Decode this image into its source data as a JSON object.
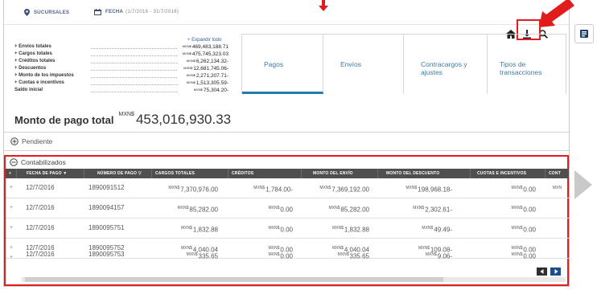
{
  "filters": {
    "branches_label": "SUCURSALES",
    "date_label": "FECHA",
    "date_range": "(1/7/2016 - 31/7/2016)"
  },
  "summary": {
    "expand_label": "+ Expandir todo",
    "rows": [
      {
        "label": "+ Envíos totales",
        "currency": "MXN$",
        "value": "469,483,188.71"
      },
      {
        "label": "+ Cargos totales",
        "currency": "MXN$",
        "value": "475,745,323.03"
      },
      {
        "label": "+ Créditos totales",
        "currency": "MXN$",
        "value": "6,262,134.32-"
      },
      {
        "label": "+ Descuentos",
        "currency": "MXN$",
        "value": "12,681,745.06-"
      },
      {
        "label": "+ Monto de los impuestos",
        "currency": "MXN$",
        "value": "2,271,207.71-"
      },
      {
        "label": "+ Cuotas e incentivos",
        "currency": "MXN$",
        "value": "1,513,305.59-"
      },
      {
        "label": "Saldo inicial",
        "currency": "MXN$",
        "value": "75,304.20-"
      }
    ],
    "total_label": "Monto de pago total",
    "total_currency": "MXN$",
    "total_value": "453,016,930.33"
  },
  "tabs": [
    {
      "label": "Pagos"
    },
    {
      "label": "Envíos"
    },
    {
      "label": "Contracargos y ajustes"
    },
    {
      "label": "Tipos de transacciones"
    }
  ],
  "sections": {
    "pending": "Pendiente",
    "posted": "Contabilizados"
  },
  "table": {
    "columns": [
      "+",
      "FECHA DE PAGO ▼",
      "NÚMERO DE PAGO ▽",
      "CARGOS TOTALES",
      "CRÉDITOS",
      "MONTO DEL ENVÍO",
      "MONTO DEL DESCUENTO",
      "CUOTAS E INCENTIVOS",
      "CONT"
    ],
    "rows": [
      {
        "date": "12/7/2016",
        "number": "1890091512",
        "charges": "7,370,976.00",
        "credits": "1,784.00-",
        "shipment": "7,369,192.00",
        "discount": "198,968.18-",
        "fees": "0.00",
        "extra": "MXN"
      },
      {
        "date": "12/7/2016",
        "number": "1890094157",
        "charges": "85,282.00",
        "credits": "0.00",
        "shipment": "85,282.00",
        "discount": "2,302.61-",
        "fees": "0.00",
        "extra": ""
      },
      {
        "date": "12/7/2016",
        "number": "1890095751",
        "charges": "1,832.88",
        "credits": "0.00",
        "shipment": "1,832.88",
        "discount": "49.49-",
        "fees": "0.00",
        "extra": ""
      },
      {
        "date": "12/7/2016",
        "number": "1890095752",
        "charges": "4,040.04",
        "credits": "0.00",
        "shipment": "4,040.04",
        "discount": "109.08-",
        "fees": "0.00",
        "extra": ""
      },
      {
        "date": "12/7/2016",
        "number": "1890095753",
        "charges": "335.65",
        "credits": "0.00",
        "shipment": "335.65",
        "discount": "9.06-",
        "fees": "0.00",
        "extra": ""
      }
    ],
    "currency": "MXN$"
  },
  "colors": {
    "accent": "#1e7faa",
    "highlight": "#e01c1c",
    "header_bg": "#4f4f4f"
  },
  "icons": [
    "location-pin-icon",
    "calendar-icon",
    "home-icon",
    "download-icon",
    "search-icon",
    "chevron-right-icon"
  ]
}
